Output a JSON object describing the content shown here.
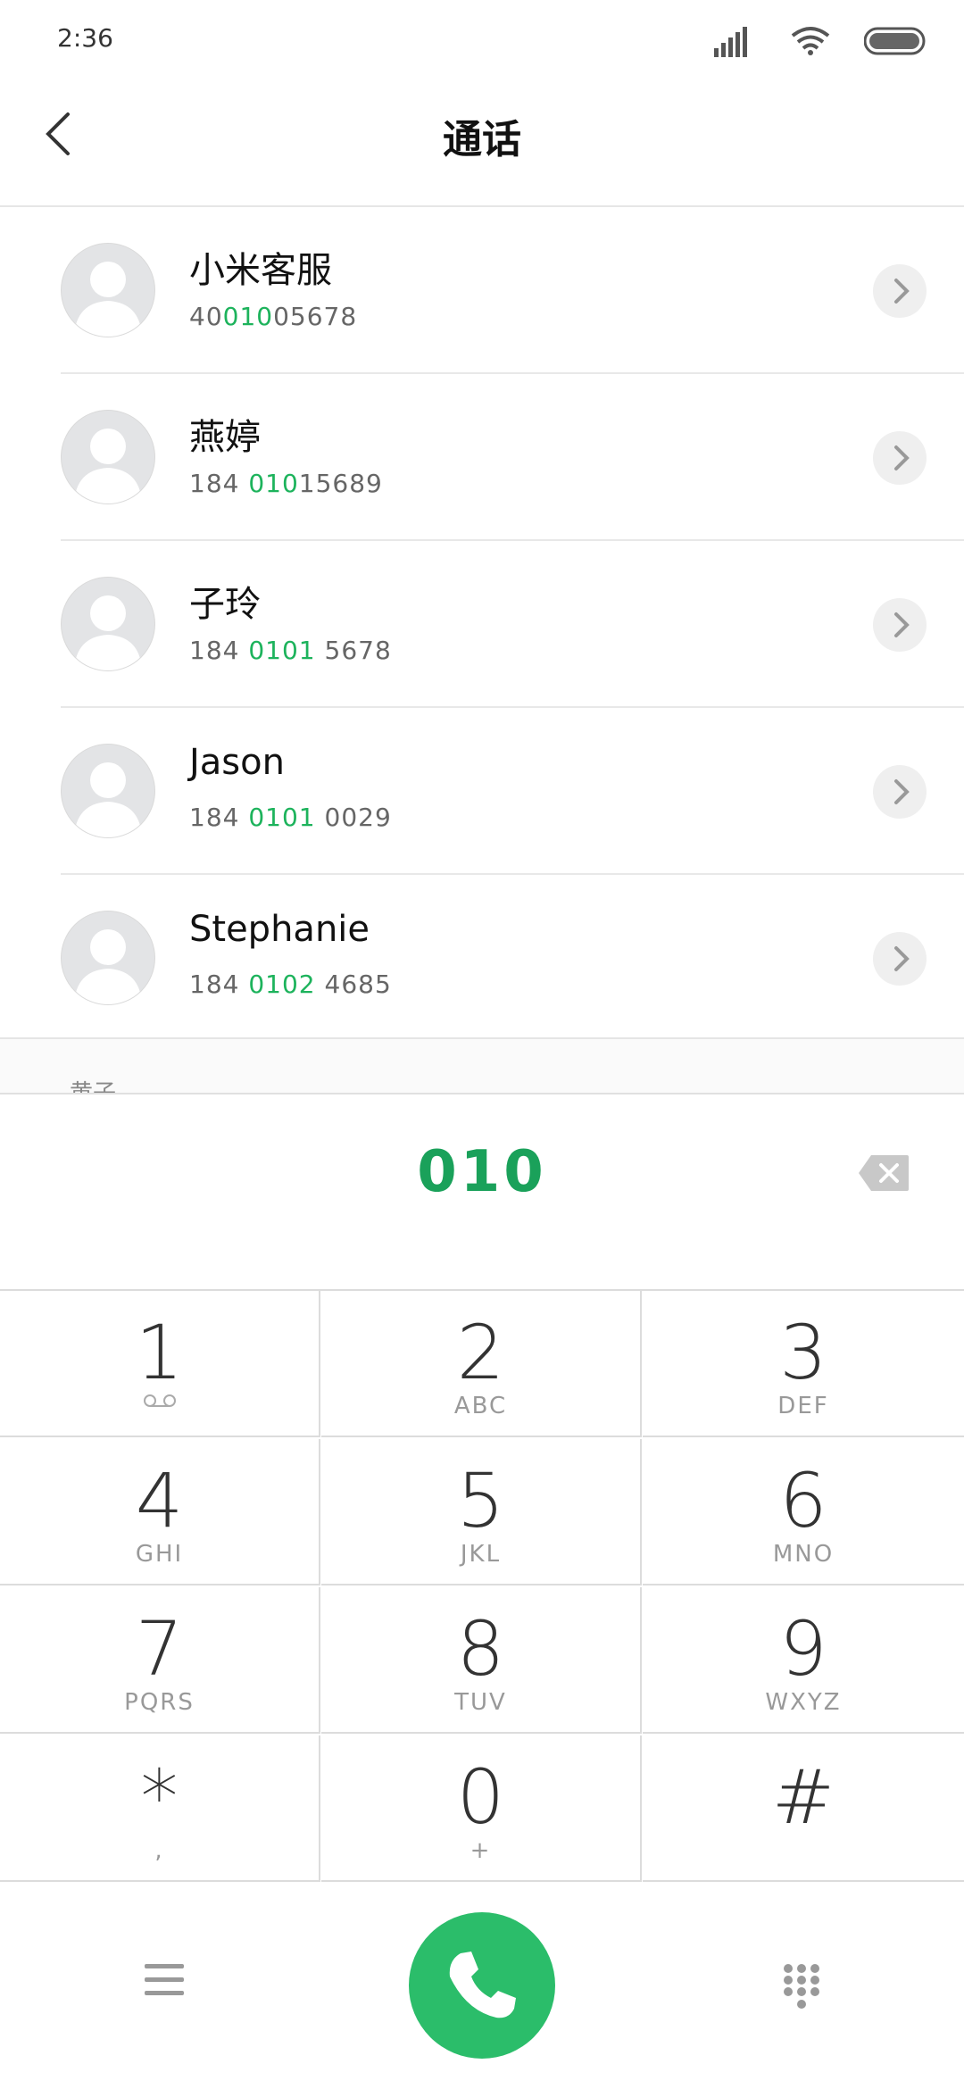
{
  "status_bar": {
    "time": "2:36"
  },
  "header": {
    "title": "通话"
  },
  "contacts": [
    {
      "name": "小米客服",
      "number_pre": "40",
      "number_hl": "010",
      "number_post": "05678"
    },
    {
      "name": "燕婷",
      "number_pre": "184 ",
      "number_hl": "010",
      "number_post": "15689"
    },
    {
      "name": "子玲",
      "number_pre": "184 ",
      "number_hl": "0101",
      "number_post": " 5678"
    },
    {
      "name": "Jason",
      "number_pre": "184 ",
      "number_hl": "0101",
      "number_post": " 0029"
    },
    {
      "name": "Stephanie",
      "number_pre": "184 ",
      "number_hl": "0102",
      "number_post": " 4685"
    }
  ],
  "peek_label": "黄子",
  "dial_input": "010",
  "keypad": [
    {
      "digit": "1",
      "letters": ""
    },
    {
      "digit": "2",
      "letters": "ABC"
    },
    {
      "digit": "3",
      "letters": "DEF"
    },
    {
      "digit": "4",
      "letters": "GHI"
    },
    {
      "digit": "5",
      "letters": "JKL"
    },
    {
      "digit": "6",
      "letters": "MNO"
    },
    {
      "digit": "7",
      "letters": "PQRS"
    },
    {
      "digit": "8",
      "letters": "TUV"
    },
    {
      "digit": "9",
      "letters": "WXYZ"
    },
    {
      "digit": "*",
      "letters": ","
    },
    {
      "digit": "0",
      "letters": "+"
    },
    {
      "digit": "#",
      "letters": ""
    }
  ],
  "colors": {
    "accent": "#1db35c",
    "call_button": "#2bbd6a"
  },
  "icons": [
    "back-arrow-icon",
    "chevron-right-icon",
    "backspace-icon",
    "voicemail-icon",
    "menu-icon",
    "phone-icon",
    "dialpad-icon"
  ]
}
